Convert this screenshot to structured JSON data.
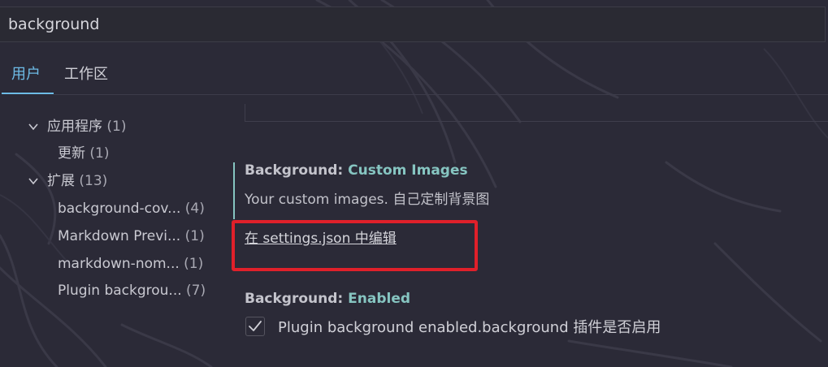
{
  "search": {
    "value": "background"
  },
  "tabs": [
    {
      "label": "用户",
      "active": true
    },
    {
      "label": "工作区",
      "active": false
    }
  ],
  "tree": [
    {
      "label": "应用程序",
      "count": "(1)",
      "expanded": true
    },
    {
      "label": "更新",
      "count": "(1)"
    },
    {
      "label": "扩展",
      "count": "(13)",
      "expanded": true
    },
    {
      "label": "background-cov...",
      "count": "(4)"
    },
    {
      "label": "Markdown Previ...",
      "count": "(1)"
    },
    {
      "label": "markdown-nom...",
      "count": "(1)"
    },
    {
      "label": "Plugin backgrou...",
      "count": "(7)"
    }
  ],
  "settings": {
    "custom_images": {
      "category": "Background: ",
      "name": "Custom Images",
      "description": "Your custom images. 自己定制背景图",
      "edit_link": "在 settings.json 中编辑"
    },
    "enabled": {
      "category": "Background: ",
      "name": "Enabled",
      "checked": true,
      "label": "Plugin background enabled.background 插件是否启用"
    }
  },
  "colors": {
    "accent_tab": "#6dbbe6",
    "setting_name": "#86c5c1",
    "highlight": "#e0202a",
    "background": "#2b2a37"
  }
}
